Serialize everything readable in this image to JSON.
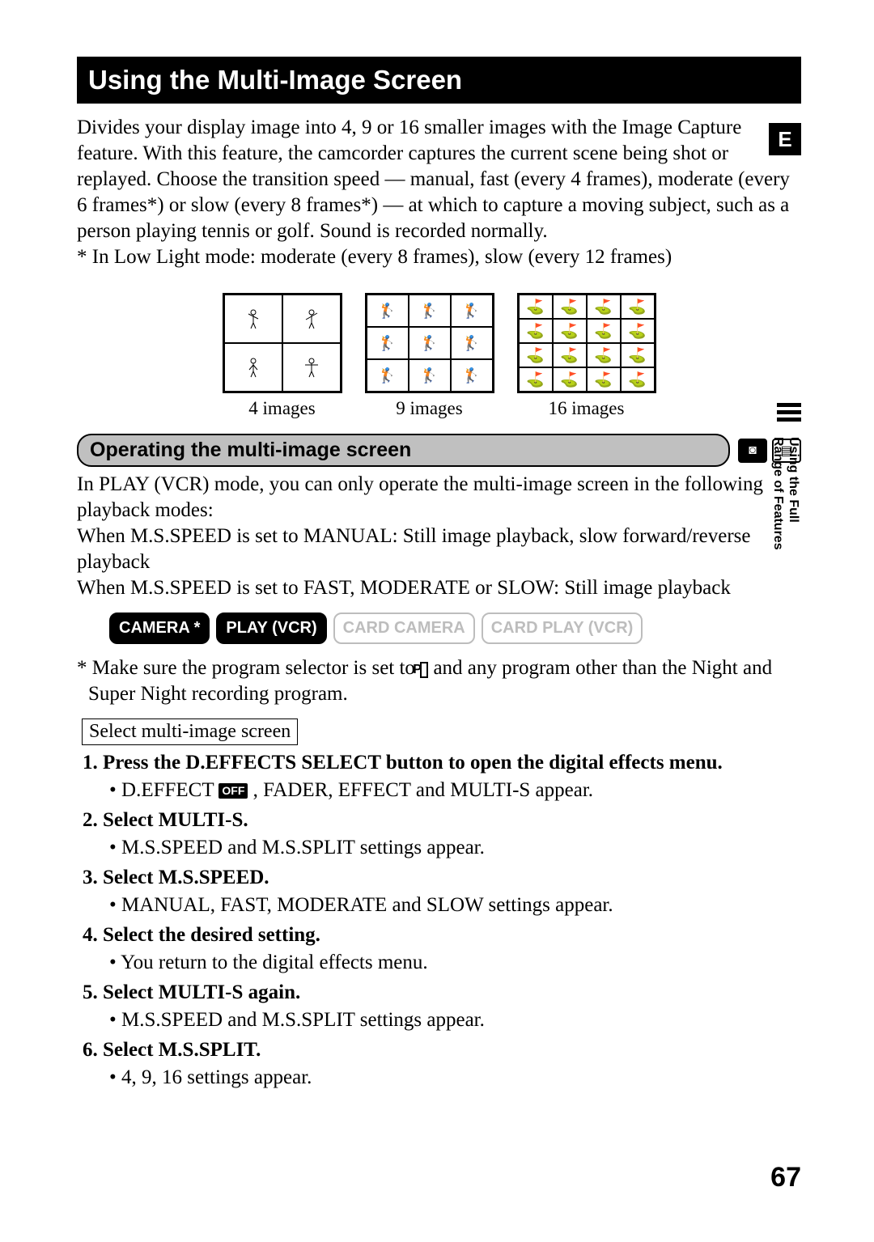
{
  "title": "Using the Multi-Image Screen",
  "intro": "Divides your display image into 4, 9 or 16 smaller images with the Image Capture feature. With this feature, the camcorder captures the current scene being shot or replayed. Choose the transition speed — manual, fast (every 4 frames), moderate (every 6 frames*) or slow (every 8 frames*) — at which to capture a moving subject, such as a person playing tennis or golf. Sound is recorded normally.",
  "intro_note": "* In Low Light mode: moderate (every 8 frames), slow (every 12 frames)",
  "diagrams": {
    "label4": "4 images",
    "label9": "9 images",
    "label16": "16 images"
  },
  "section_heading": "Operating the multi-image screen",
  "section_body": "In PLAY (VCR) mode, you can only operate the multi-image screen in the following playback modes:\nWhen M.S.SPEED is set to MANUAL: Still image playback, slow forward/reverse playback\nWhen M.S.SPEED is set to FAST, MODERATE or SLOW: Still image playback",
  "modes": {
    "camera": "CAMERA *",
    "play": "PLAY (VCR)",
    "card_camera": "CARD CAMERA",
    "card_play": "CARD PLAY (VCR)"
  },
  "mode_note_pre": "* Make sure the program selector is set to ",
  "mode_note_post": " and any program other than the Night and Super Night recording program.",
  "p_symbol": "P",
  "procedure_label": "Select multi-image screen",
  "steps": [
    {
      "title": "Press the D.EFFECTS SELECT button to open the digital effects menu.",
      "sub_pre": "D.EFFECT ",
      "off": "OFF",
      "sub_post": " , FADER, EFFECT and MULTI-S appear."
    },
    {
      "title": "Select MULTI-S.",
      "sub": "M.S.SPEED and M.S.SPLIT settings appear."
    },
    {
      "title": "Select M.S.SPEED.",
      "sub": "MANUAL, FAST, MODERATE and SLOW settings appear."
    },
    {
      "title": "Select the desired setting.",
      "sub": "You return to the digital effects menu."
    },
    {
      "title": "Select MULTI-S again.",
      "sub": "M.S.SPEED and M.S.SPLIT settings appear."
    },
    {
      "title": "Select M.S.SPLIT.",
      "sub": "4, 9, 16 settings appear."
    }
  ],
  "side_tab": "E",
  "side_label_1": "Using the Full",
  "side_label_2": "Range of Features",
  "page_number": "67"
}
